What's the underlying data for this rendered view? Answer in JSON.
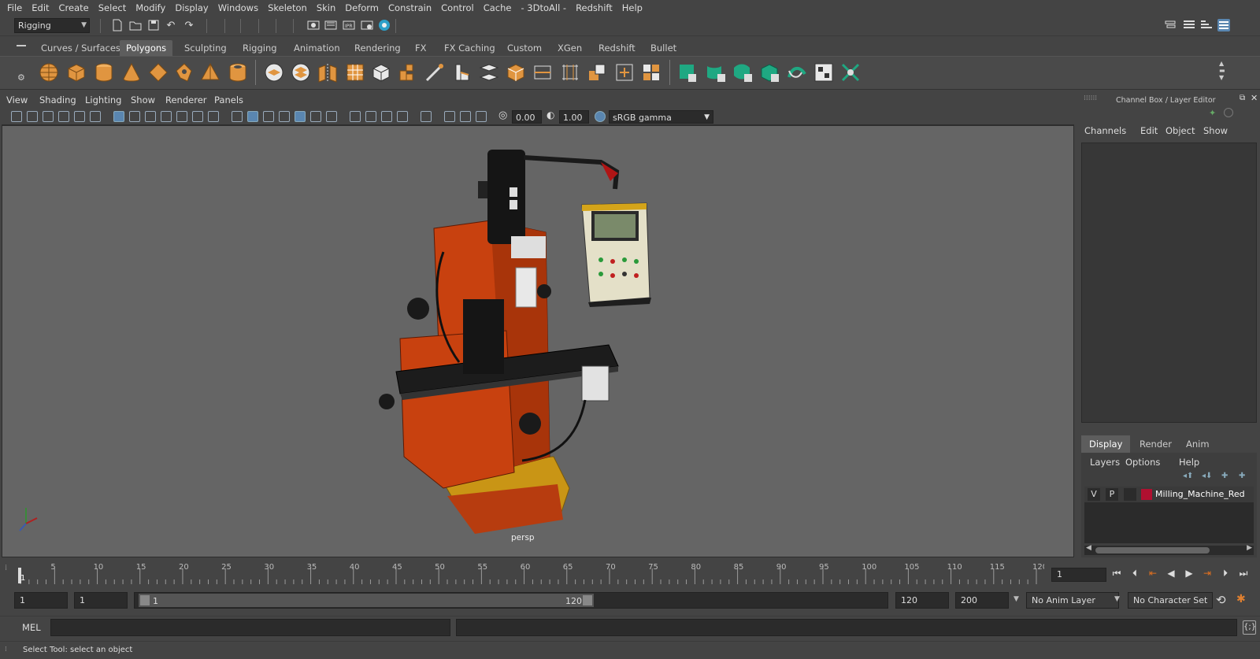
{
  "menubar": {
    "items": [
      "File",
      "Edit",
      "Create",
      "Select",
      "Modify",
      "Display",
      "Windows",
      "Skeleton",
      "Skin",
      "Deform",
      "Constrain",
      "Control",
      "Cache",
      "- 3DtoAll -",
      "Redshift",
      "Help"
    ]
  },
  "statusline": {
    "mode_selected": "Rigging"
  },
  "shelf": {
    "tabs": [
      "Curves / Surfaces",
      "Polygons",
      "Sculpting",
      "Rigging",
      "Animation",
      "Rendering",
      "FX",
      "FX Caching",
      "Custom",
      "XGen",
      "Redshift",
      "Bullet"
    ],
    "active_tab": "Polygons"
  },
  "viewport": {
    "menu": [
      "View",
      "Shading",
      "Lighting",
      "Show",
      "Renderer",
      "Panels"
    ],
    "exposure": "0.00",
    "gamma": "1.00",
    "color_space": "sRGB gamma",
    "camera_label": "persp",
    "colors": {
      "background": "#656565",
      "machine_orange": "#c8410f",
      "base_yellow": "#d6a818"
    }
  },
  "channelbox": {
    "title": "Channel Box / Layer Editor",
    "menu": [
      "Channels",
      "Edit",
      "Object",
      "Show"
    ]
  },
  "layer_editor": {
    "tabs": [
      "Display",
      "Render",
      "Anim"
    ],
    "active_tab": "Display",
    "menu": [
      "Layers",
      "Options",
      "Help"
    ],
    "layers": [
      {
        "visible": "V",
        "playback": "P",
        "color": "#b01030",
        "name": "Milling_Machine_Red"
      }
    ]
  },
  "timeline": {
    "ticks": [
      "5",
      "10",
      "15",
      "20",
      "25",
      "30",
      "35",
      "40",
      "45",
      "50",
      "55",
      "60",
      "65",
      "70",
      "75",
      "80",
      "85",
      "90",
      "95",
      "100",
      "105",
      "110",
      "115",
      "120"
    ],
    "current_frame_marker": "1",
    "current_frame": "1"
  },
  "range": {
    "start": "1",
    "playback_start": "1",
    "slider_start": "1",
    "slider_end": "120",
    "playback_end": "120",
    "end": "200",
    "anim_layer": "No Anim Layer",
    "character_set": "No Character Set"
  },
  "commandline": {
    "language": "MEL"
  },
  "helpline": {
    "text": "Select Tool: select an object"
  }
}
